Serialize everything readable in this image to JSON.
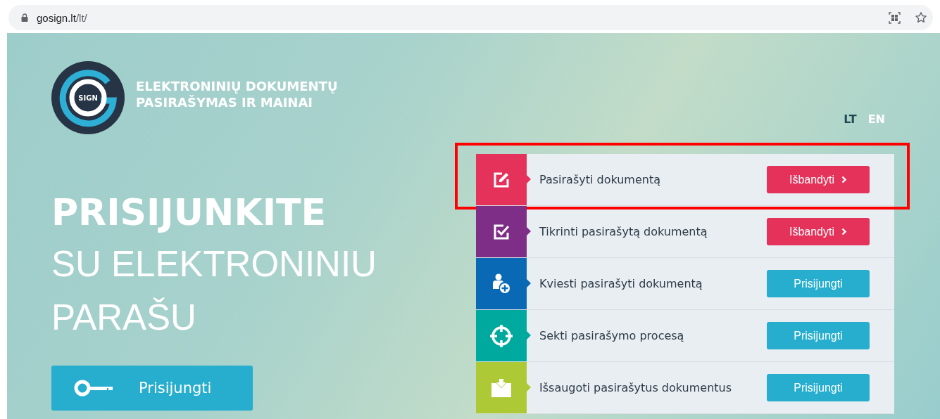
{
  "browser": {
    "url_host": "gosign.lt",
    "url_path": "/lt/"
  },
  "logo": {
    "badge": "SIGN",
    "title_lines": [
      "ELEKTRONINIŲ DOKUMENTŲ",
      "PASIRAŠYMAS IR MAINAI"
    ]
  },
  "languages": [
    {
      "label": "LT",
      "selected": true
    },
    {
      "label": "EN",
      "selected": false
    }
  ],
  "hero": {
    "headline": "PRISIJUNKITE",
    "subline_1": "SU ELEKTRONINIU",
    "subline_2": "PARAŠU",
    "login_button": "Prisijungti"
  },
  "services": [
    {
      "label": "Pasirašyti dokumentą",
      "kind": "edit",
      "color": "#e4325a",
      "button": {
        "kind": "try",
        "label": "Išbandyti"
      },
      "highlighted": true
    },
    {
      "label": "Tikrinti pasirašytą dokumentą",
      "kind": "check",
      "color": "#7e2e86",
      "button": {
        "kind": "try",
        "label": "Išbandyti"
      },
      "highlighted": false
    },
    {
      "label": "Kviesti pasirašyti dokumentą",
      "kind": "invite",
      "color": "#0a69b5",
      "button": {
        "kind": "login",
        "label": "Prisijungti"
      },
      "highlighted": false
    },
    {
      "label": "Sekti pasirašymo procesą",
      "kind": "target",
      "color": "#00a99d",
      "button": {
        "kind": "login",
        "label": "Prisijungti"
      },
      "highlighted": false
    },
    {
      "label": "Išsaugoti pasirašytus dokumentus",
      "kind": "save",
      "color": "#aec936",
      "button": {
        "kind": "login",
        "label": "Prisijungti"
      },
      "highlighted": false
    }
  ]
}
